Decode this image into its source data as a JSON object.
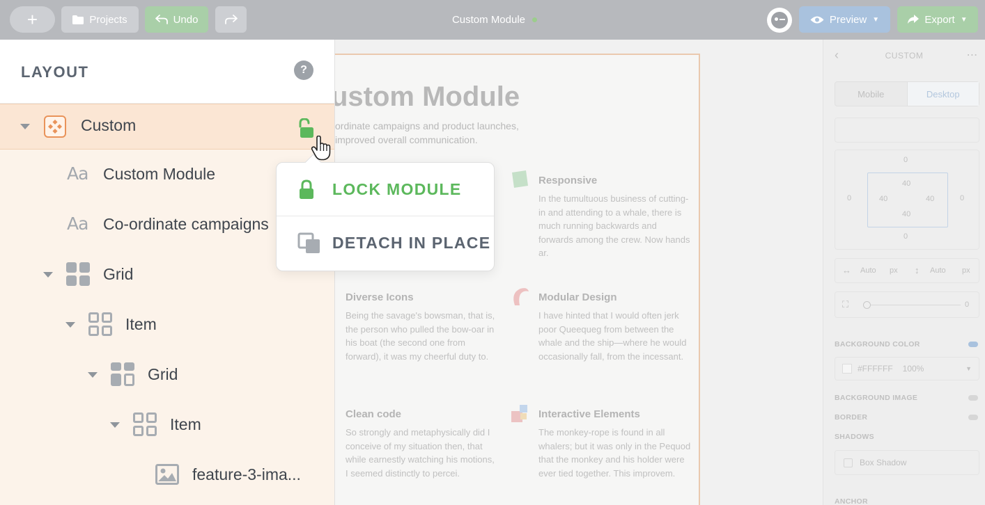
{
  "topbar": {
    "add_label": "+",
    "projects_label": "Projects",
    "undo_label": "Undo",
    "document_title": "Custom Module",
    "preview_label": "Preview",
    "export_label": "Export",
    "colors": {
      "bar": "#b7b9bd",
      "preview": "#a9c2de",
      "export": "#a9cfa8",
      "saved_dot": "#9ccd8c"
    }
  },
  "layout_panel": {
    "title": "LAYOUT",
    "help_label": "?",
    "tree": [
      {
        "label": "Custom",
        "type": "custom",
        "depth": 0,
        "expanded": true,
        "selected": true
      },
      {
        "label": "Custom Module",
        "type": "text",
        "depth": 1
      },
      {
        "label": "Co-ordinate campaigns",
        "type": "text",
        "depth": 1
      },
      {
        "label": "Grid",
        "type": "grid",
        "depth": 1,
        "expanded": true
      },
      {
        "label": "Item",
        "type": "grid-item",
        "depth": 2,
        "expanded": true
      },
      {
        "label": "Grid",
        "type": "grid",
        "depth": 3,
        "expanded": true
      },
      {
        "label": "Item",
        "type": "grid-item",
        "depth": 4,
        "expanded": true
      },
      {
        "label": "feature-3-ima...",
        "type": "image",
        "depth": 5
      }
    ],
    "text_icon_glyph": "Aa"
  },
  "popup_menu": {
    "items": [
      {
        "label": "LOCK MODULE",
        "icon": "lock-icon",
        "color": "#5cb85c"
      },
      {
        "label": "DETACH IN PLACE",
        "icon": "detach-icon",
        "color": "#5b6470"
      }
    ]
  },
  "canvas": {
    "heading": "ustom Module",
    "intro": "ordinate campaigns and product launches, improved overall communication.",
    "features": [
      {
        "title": "Responsive",
        "body": "In the tumultuous business of cutting-in and attending to a whale, there is much running backwards and forwards among the crew. Now hands ar."
      },
      {
        "title": "Diverse Icons",
        "body": "Being the savage's bowsman, that is, the person who pulled the bow-oar in his boat (the second one from forward), it was my cheerful duty to."
      },
      {
        "title": "Modular Design",
        "body": "I have hinted that I would often jerk poor Queequeg from between the whale and the ship—where he would occasionally fall, from the incessant."
      },
      {
        "title": "Clean code",
        "body": "So strongly and metaphysically did I conceive of my situation then, that while earnestly watching his motions, I seemed distinctly to percei."
      },
      {
        "title": "Interactive Elements",
        "body": "The monkey-rope is found in all whalers; but it was only in the Pequod that the monkey and his holder were ever tied together. This improvem."
      }
    ]
  },
  "inspector": {
    "title": "CUSTOM",
    "tabs": [
      "Mobile",
      "Desktop"
    ],
    "active_tab": "Desktop",
    "box_model": {
      "margin_top": "0",
      "margin_right": "0",
      "margin_bottom": "0",
      "margin_left": "0",
      "padding_top": "40",
      "padding_right": "40",
      "padding_bottom": "40",
      "padding_left": "40"
    },
    "width_placeholder": "Auto",
    "height_placeholder": "Auto",
    "unit": "px",
    "radius_value": "0",
    "background_color_label": "BACKGROUND COLOR",
    "background_color_value": "#FFFFFF",
    "background_opacity": "100%",
    "background_image_label": "BACKGROUND IMAGE",
    "border_label": "BORDER",
    "shadows_label": "SHADOWS",
    "box_shadow_label": "Box Shadow",
    "anchor_label": "ANCHOR"
  }
}
